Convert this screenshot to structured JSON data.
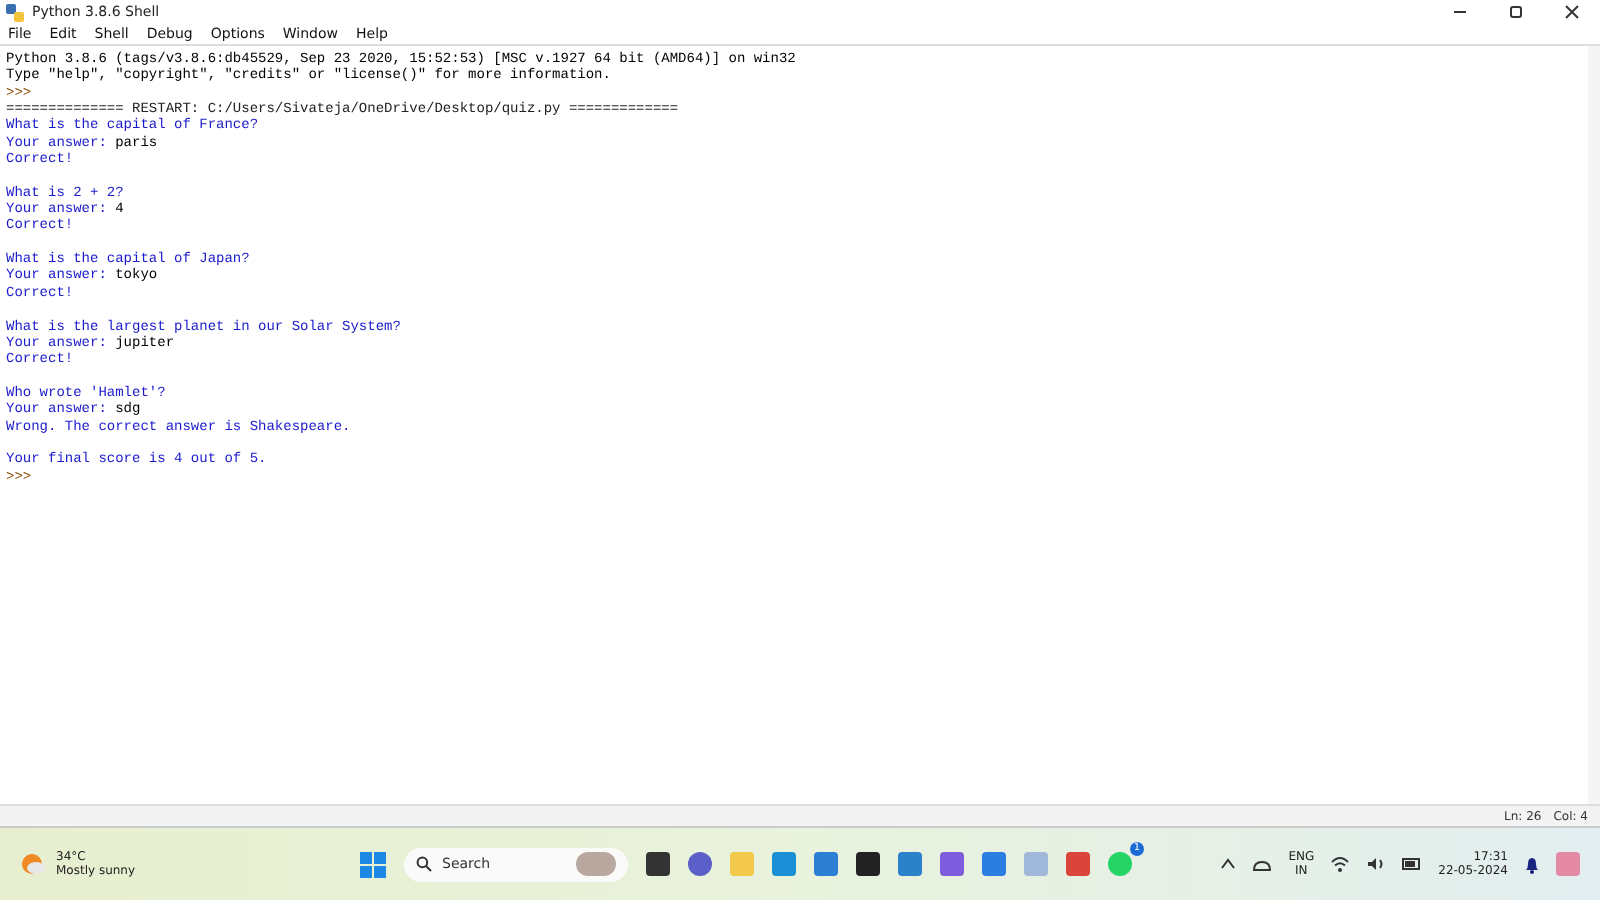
{
  "window": {
    "title": "Python 3.8.6 Shell"
  },
  "menu": [
    "File",
    "Edit",
    "Shell",
    "Debug",
    "Options",
    "Window",
    "Help"
  ],
  "shell_lines": [
    {
      "kind": "banner",
      "text": "Python 3.8.6 (tags/v3.8.6:db45529, Sep 23 2020, 15:52:53) [MSC v.1927 64 bit (AMD64)] on win32"
    },
    {
      "kind": "banner",
      "text": "Type \"help\", \"copyright\", \"credits\" or \"license()\" for more information."
    },
    {
      "kind": "prompt",
      "text": ">>>"
    },
    {
      "kind": "restart",
      "text": "============== RESTART: C:/Users/Sivateja/OneDrive/Desktop/quiz.py ============="
    },
    {
      "kind": "output",
      "text": "What is the capital of France?"
    },
    {
      "kind": "answer",
      "text": "Your answer: ",
      "value": "paris"
    },
    {
      "kind": "output",
      "text": "Correct!"
    },
    {
      "kind": "blank"
    },
    {
      "kind": "output",
      "text": "What is 2 + 2?"
    },
    {
      "kind": "answer",
      "text": "Your answer: ",
      "value": "4"
    },
    {
      "kind": "output",
      "text": "Correct!"
    },
    {
      "kind": "blank"
    },
    {
      "kind": "output",
      "text": "What is the capital of Japan?"
    },
    {
      "kind": "answer",
      "text": "Your answer: ",
      "value": "tokyo"
    },
    {
      "kind": "output",
      "text": "Correct!"
    },
    {
      "kind": "blank"
    },
    {
      "kind": "output",
      "text": "What is the largest planet in our Solar System?"
    },
    {
      "kind": "answer",
      "text": "Your answer: ",
      "value": "jupiter"
    },
    {
      "kind": "output",
      "text": "Correct!"
    },
    {
      "kind": "blank"
    },
    {
      "kind": "output",
      "text": "Who wrote 'Hamlet'?"
    },
    {
      "kind": "answer",
      "text": "Your answer: ",
      "value": "sdg"
    },
    {
      "kind": "output",
      "text": "Wrong. The correct answer is Shakespeare."
    },
    {
      "kind": "blank"
    },
    {
      "kind": "output",
      "text": "Your final score is 4 out of 5."
    },
    {
      "kind": "prompt",
      "text": ">>>"
    }
  ],
  "status_bar": {
    "line": "Ln: 26",
    "column": "Col: 4"
  },
  "taskbar": {
    "weather_temp": "34°C",
    "weather_desc": "Mostly sunny",
    "search": "Search",
    "language": "ENG",
    "region": "IN",
    "time": "17:31",
    "date": "22-05-2024",
    "whatsapp_badge": "1"
  }
}
